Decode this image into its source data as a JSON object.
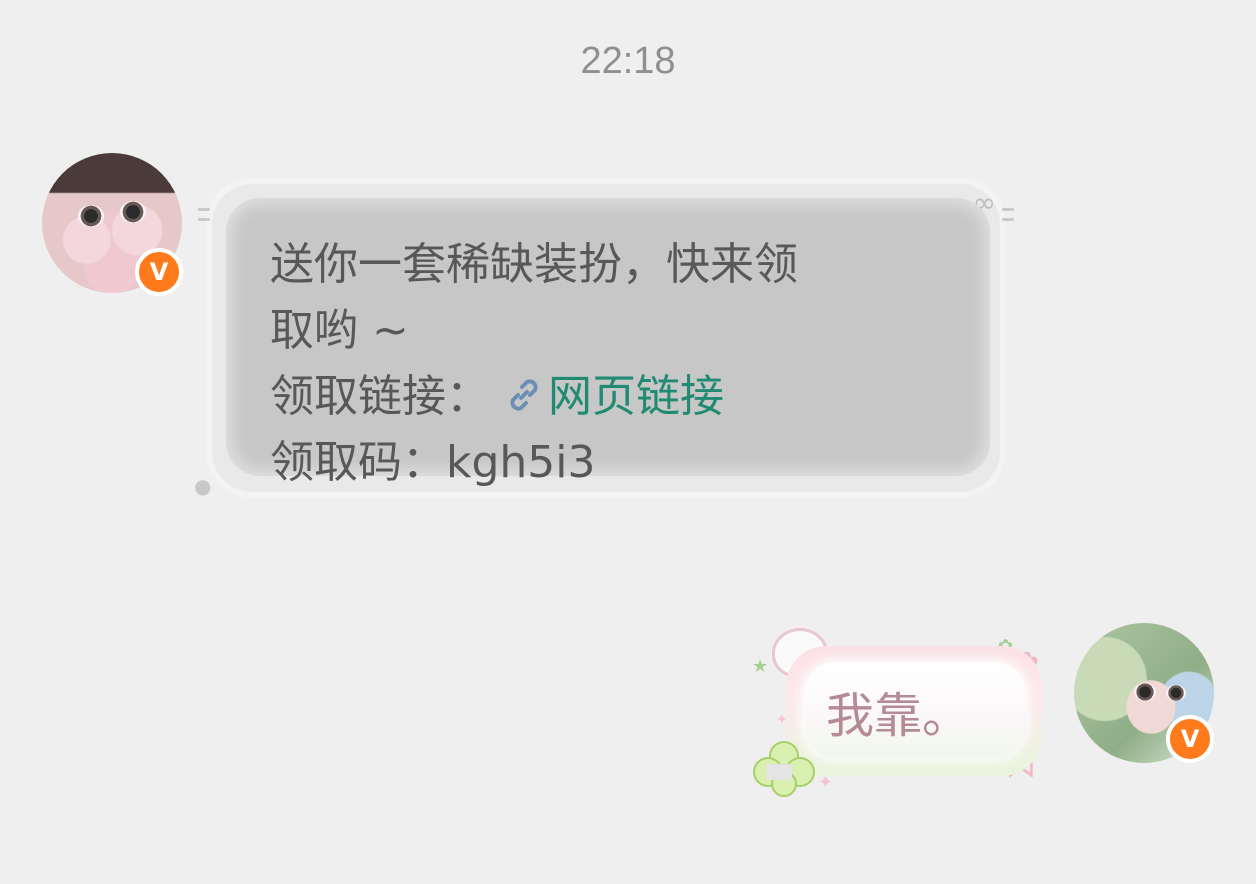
{
  "timestamp": "22:18",
  "messages": [
    {
      "side": "left",
      "avatar": "avatar-girl-dark-hair",
      "verified_badge": "V",
      "lines": [
        "送你一套稀缺装扮，快来领",
        "取哟 ~"
      ],
      "link_prefix": "领取链接：",
      "link_icon": "link-icon",
      "link_text": "网页链接",
      "code_line": "领取码：kgh5i3"
    },
    {
      "side": "right",
      "avatar": "avatar-girl-green-hair",
      "verified_badge": "V",
      "text": "我靠。"
    }
  ],
  "colors": {
    "background": "#efefef",
    "timestamp": "#8f8f8f",
    "left_bubble": "#c7c7c7",
    "left_text": "#585858",
    "link": "#218a73",
    "right_text": "#b58a97",
    "badge": "#ff7a1a"
  }
}
